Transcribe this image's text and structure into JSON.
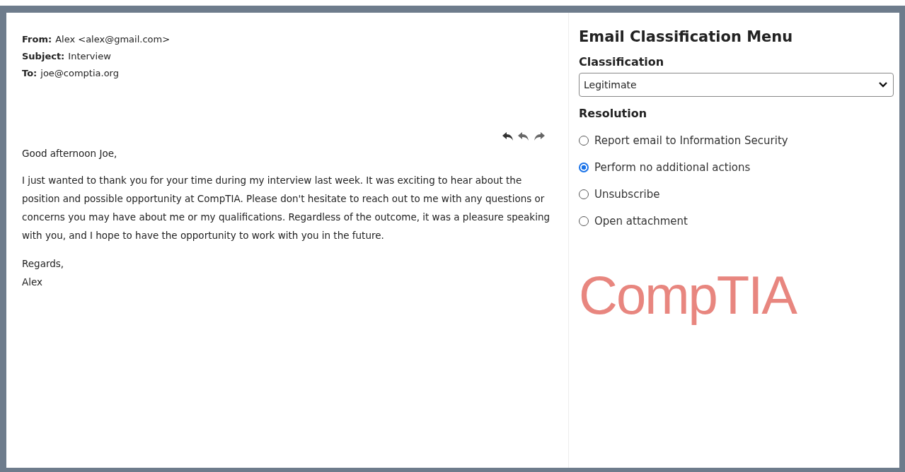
{
  "email": {
    "headers": [
      {
        "label": "From:",
        "value": "Alex <alex@gmail.com>"
      },
      {
        "label": "Subject:",
        "value": "Interview"
      },
      {
        "label": "To:",
        "value": "joe@comptia.org"
      }
    ],
    "greeting": "Good afternoon Joe,",
    "body": "I just wanted to thank you for your time during my interview last week. It was exciting to hear about the position and possible opportunity at CompTIA. Please don't hesitate to reach out to me with any questions or concerns you may have about me or my qualifications. Regardless of the outcome, it was a pleasure speaking with you, and I hope to have the opportunity to work with you in the future.",
    "closing": "Regards,",
    "signature": "Alex"
  },
  "menu": {
    "title": "Email Classification Menu",
    "classification_label": "Classification",
    "classification_value": "Legitimate",
    "resolution_label": "Resolution",
    "options": [
      {
        "label": "Report email to Information Security",
        "selected": false
      },
      {
        "label": "Perform no additional actions",
        "selected": true
      },
      {
        "label": "Unsubscribe",
        "selected": false
      },
      {
        "label": "Open attachment",
        "selected": false
      }
    ]
  },
  "logo": "CompTIA"
}
